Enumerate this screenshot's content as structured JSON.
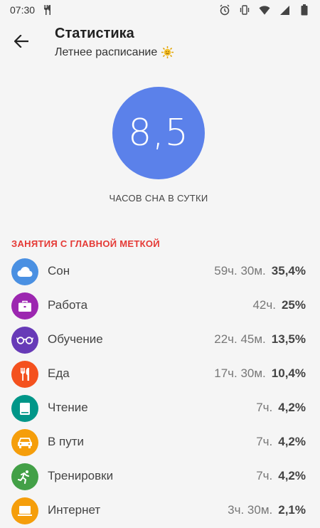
{
  "status_bar": {
    "time": "07:30",
    "icons": [
      "fork-knife-icon",
      "alarm-icon",
      "vibrate-icon",
      "wifi-icon",
      "signal-icon",
      "battery-icon"
    ]
  },
  "header": {
    "title": "Статистика",
    "subtitle": "Летнее расписание",
    "subtitle_icon": "sun-icon"
  },
  "summary": {
    "value": "8,5",
    "caption": "ЧАСОВ СНА В СУТКИ",
    "circle_color": "#5b81ea"
  },
  "section": {
    "title": "ЗАНЯТИЯ С ГЛАВНОЙ МЕТКОЙ",
    "title_color": "#e53935"
  },
  "activities": [
    {
      "label": "Сон",
      "time": "59ч. 30м.",
      "percent": "35,4%",
      "color": "#4a90e2",
      "icon": "cloud-icon"
    },
    {
      "label": "Работа",
      "time": "42ч.",
      "percent": "25%",
      "color": "#9c27b0",
      "icon": "briefcase-icon"
    },
    {
      "label": "Обучение",
      "time": "22ч. 45м.",
      "percent": "13,5%",
      "color": "#673ab7",
      "icon": "glasses-icon"
    },
    {
      "label": "Еда",
      "time": "17ч. 30м.",
      "percent": "10,4%",
      "color": "#f4511e",
      "icon": "fork-knife-icon"
    },
    {
      "label": "Чтение",
      "time": "7ч.",
      "percent": "4,2%",
      "color": "#009688",
      "icon": "book-icon"
    },
    {
      "label": "В пути",
      "time": "7ч.",
      "percent": "4,2%",
      "color": "#f59e0b",
      "icon": "car-icon"
    },
    {
      "label": "Тренировки",
      "time": "7ч.",
      "percent": "4,2%",
      "color": "#43a047",
      "icon": "running-icon"
    },
    {
      "label": "Интернет",
      "time": "3ч. 30м.",
      "percent": "2,1%",
      "color": "#f59e0b",
      "icon": "laptop-icon"
    }
  ]
}
